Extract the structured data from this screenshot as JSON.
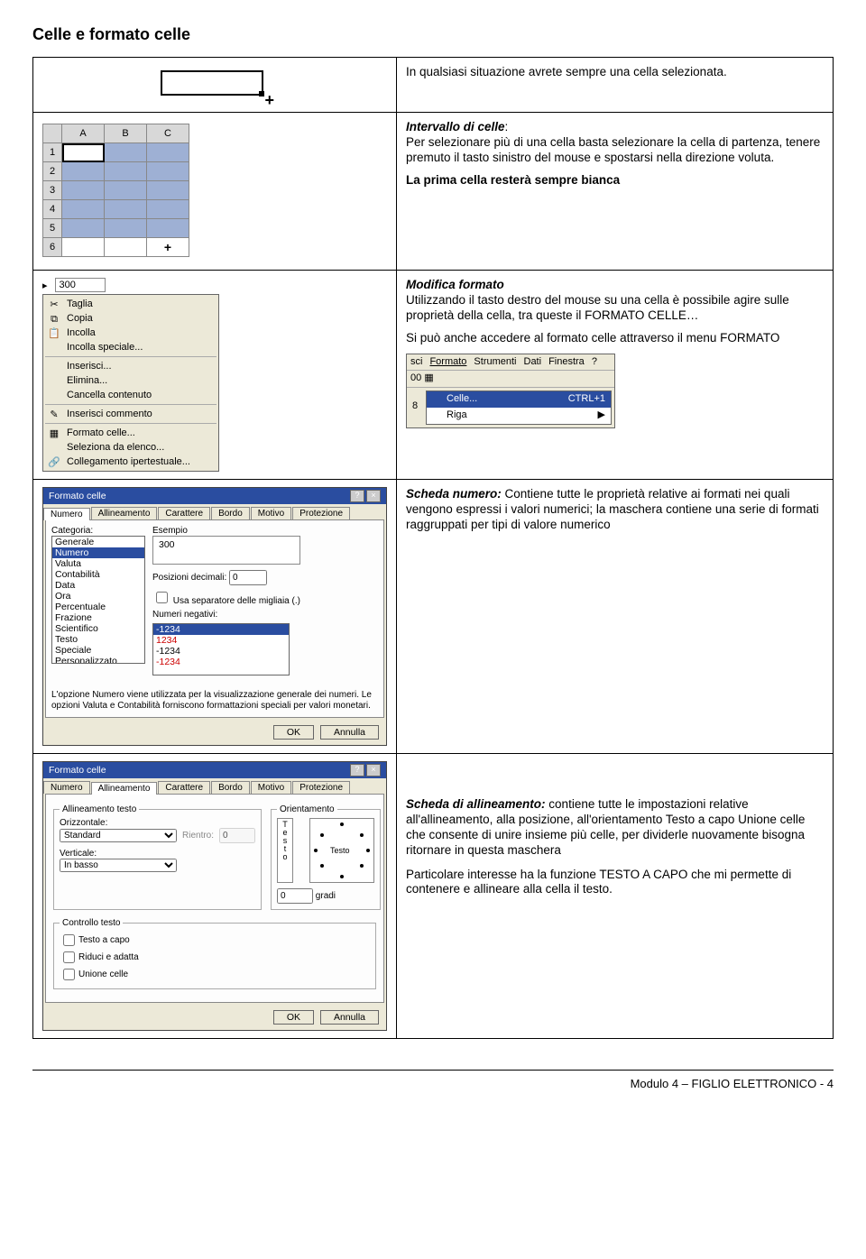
{
  "page": {
    "title": "Celle e formato celle",
    "footer": "Modulo 4 – FIGLIO ELETTRONICO - 4"
  },
  "row1": {
    "text": "In qualsiasi situazione avrete sempre una cella selezionata."
  },
  "row2": {
    "heading": "Intervallo di celle",
    "text": "Per selezionare più di una cella basta selezionare la cella di partenza, tenere premuto il tasto sinistro del mouse e spostarsi nella direzione voluta.",
    "text2": "La prima cella resterà sempre bianca",
    "grid_cols": [
      "A",
      "B",
      "C"
    ],
    "grid_rows": [
      "1",
      "2",
      "3",
      "4",
      "5",
      "6"
    ]
  },
  "row3": {
    "heading": "Modifica formato",
    "text": "Utilizzando il tasto destro del mouse su una cella è possibile agire sulle proprietà della cella, tra queste il FORMATO CELLE…",
    "text2": "Si può anche accedere al formato celle attraverso il menu FORMATO",
    "ctx_value": "300",
    "ctx_items": [
      {
        "icon": "✂",
        "label": "Taglia"
      },
      {
        "icon": "⧉",
        "label": "Copia"
      },
      {
        "icon": "📋",
        "label": "Incolla"
      },
      {
        "icon": "",
        "label": "Incolla speciale..."
      },
      {
        "icon": "",
        "label": "Inserisci..."
      },
      {
        "icon": "",
        "label": "Elimina..."
      },
      {
        "icon": "",
        "label": "Cancella contenuto"
      },
      {
        "icon": "✎",
        "label": "Inserisci commento"
      },
      {
        "icon": "▦",
        "label": "Formato celle..."
      },
      {
        "icon": "",
        "label": "Seleziona da elenco..."
      },
      {
        "icon": "🔗",
        "label": "Collegamento ipertestuale..."
      }
    ],
    "menubar": {
      "items": [
        "sci",
        "Formato",
        "Strumenti",
        "Dati",
        "Finestra",
        "?"
      ],
      "row2_left": "00",
      "drop": [
        {
          "label": "Celle...",
          "shortcut": "CTRL+1",
          "sel": true
        },
        {
          "label": "Riga",
          "shortcut": "▶",
          "sel": false
        }
      ],
      "side_label": "8"
    }
  },
  "row4": {
    "heading": "Scheda numero:",
    "text": " Contiene tutte le proprietà relative ai formati nei quali vengono espressi i valori numerici; la maschera contiene una serie di formati raggruppati per tipi di valore numerico",
    "dlg": {
      "title": "Formato celle",
      "tabs": [
        "Numero",
        "Allineamento",
        "Carattere",
        "Bordo",
        "Motivo",
        "Protezione"
      ],
      "active_tab": 0,
      "cat_label": "Categoria:",
      "categories": [
        "Generale",
        "Numero",
        "Valuta",
        "Contabilità",
        "Data",
        "Ora",
        "Percentuale",
        "Frazione",
        "Scientifico",
        "Testo",
        "Speciale",
        "Personalizzato"
      ],
      "cat_sel": 1,
      "example_label": "Esempio",
      "example_value": "300",
      "dec_label": "Posizioni decimali:",
      "dec_value": "0",
      "thousand_label": "Usa separatore delle migliaia (.)",
      "neg_label": "Numeri negativi:",
      "neg_list": [
        "-1234",
        "1234",
        "-1234",
        "-1234"
      ],
      "neg_sel": 0,
      "note": "L'opzione Numero viene utilizzata per la visualizzazione generale dei numeri. Le opzioni Valuta e Contabilità forniscono formattazioni speciali per valori monetari.",
      "ok": "OK",
      "cancel": "Annulla"
    }
  },
  "row5": {
    "heading": "Scheda di allineamento:",
    "text": " contiene tutte le impostazioni relative all'allineamento, alla posizione, all'orientamento Testo a capo Unione celle che consente di unire insieme più celle, per dividerle nuovamente bisogna ritornare in questa maschera",
    "text2": "Particolare interesse ha la funzione TESTO A CAPO che mi permette di contenere e allineare alla cella il testo.",
    "dlg": {
      "title": "Formato celle",
      "tabs": [
        "Numero",
        "Allineamento",
        "Carattere",
        "Bordo",
        "Motivo",
        "Protezione"
      ],
      "active_tab": 1,
      "grp_align": "Allineamento testo",
      "h_label": "Orizzontale:",
      "h_value": "Standard",
      "indent_label": "Rientro:",
      "indent_value": "0",
      "v_label": "Verticale:",
      "v_value": "In basso",
      "grp_orient": "Orientamento",
      "vtext": "Testo",
      "orient_center": "Testo",
      "degrees_label": "gradi",
      "degrees_value": "0",
      "grp_ctrl": "Controllo testo",
      "chk1": "Testo a capo",
      "chk2": "Riduci e adatta",
      "chk3": "Unione celle",
      "ok": "OK",
      "cancel": "Annulla"
    }
  }
}
